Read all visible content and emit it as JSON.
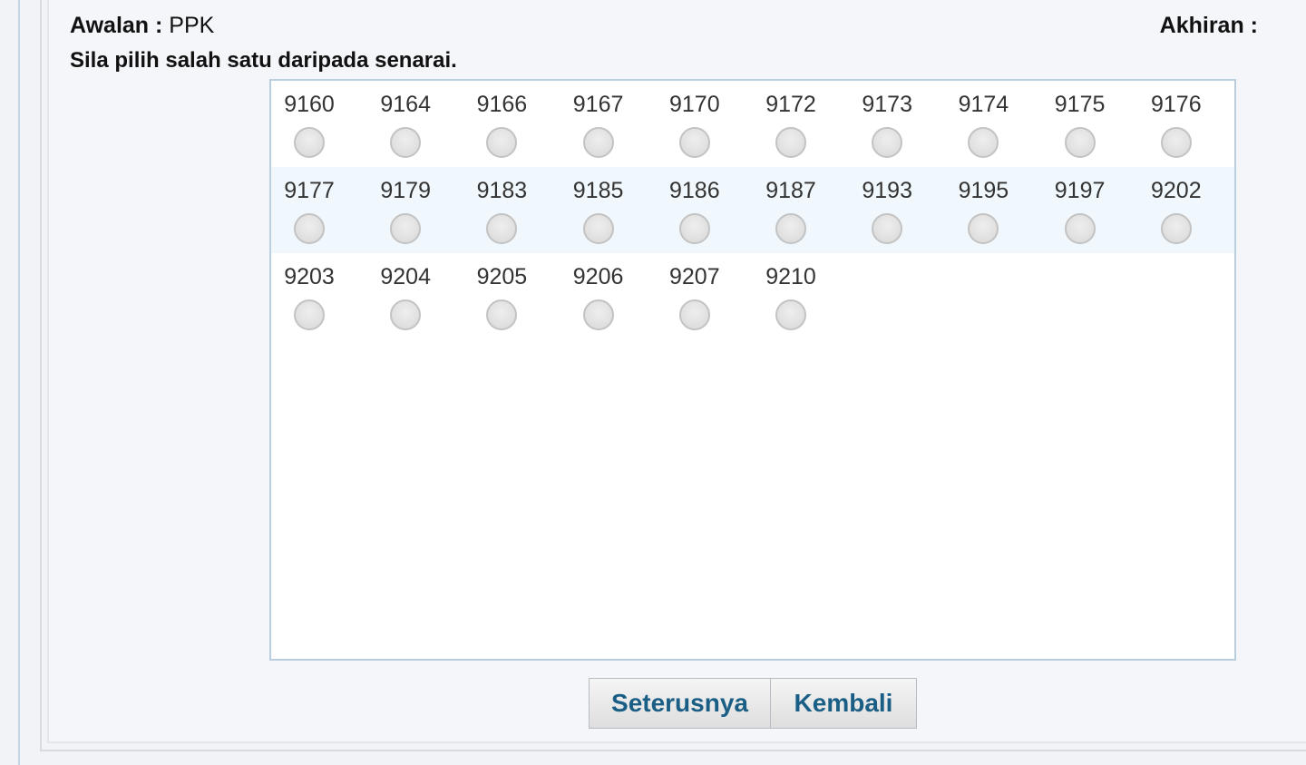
{
  "header": {
    "prefix_label": "Awalan :",
    "prefix_value": "PPK",
    "suffix_label": "Akhiran :",
    "suffix_value": ""
  },
  "instruction": "Sila pilih salah satu daripada senarai.",
  "options": [
    [
      "9160",
      "9164",
      "9166",
      "9167",
      "9170",
      "9172",
      "9173",
      "9174",
      "9175",
      "9176"
    ],
    [
      "9177",
      "9179",
      "9183",
      "9185",
      "9186",
      "9187",
      "9193",
      "9195",
      "9197",
      "9202"
    ],
    [
      "9203",
      "9204",
      "9205",
      "9206",
      "9207",
      "9210"
    ]
  ],
  "buttons": {
    "next_label": "Seterusnya",
    "back_label": "Kembali"
  }
}
